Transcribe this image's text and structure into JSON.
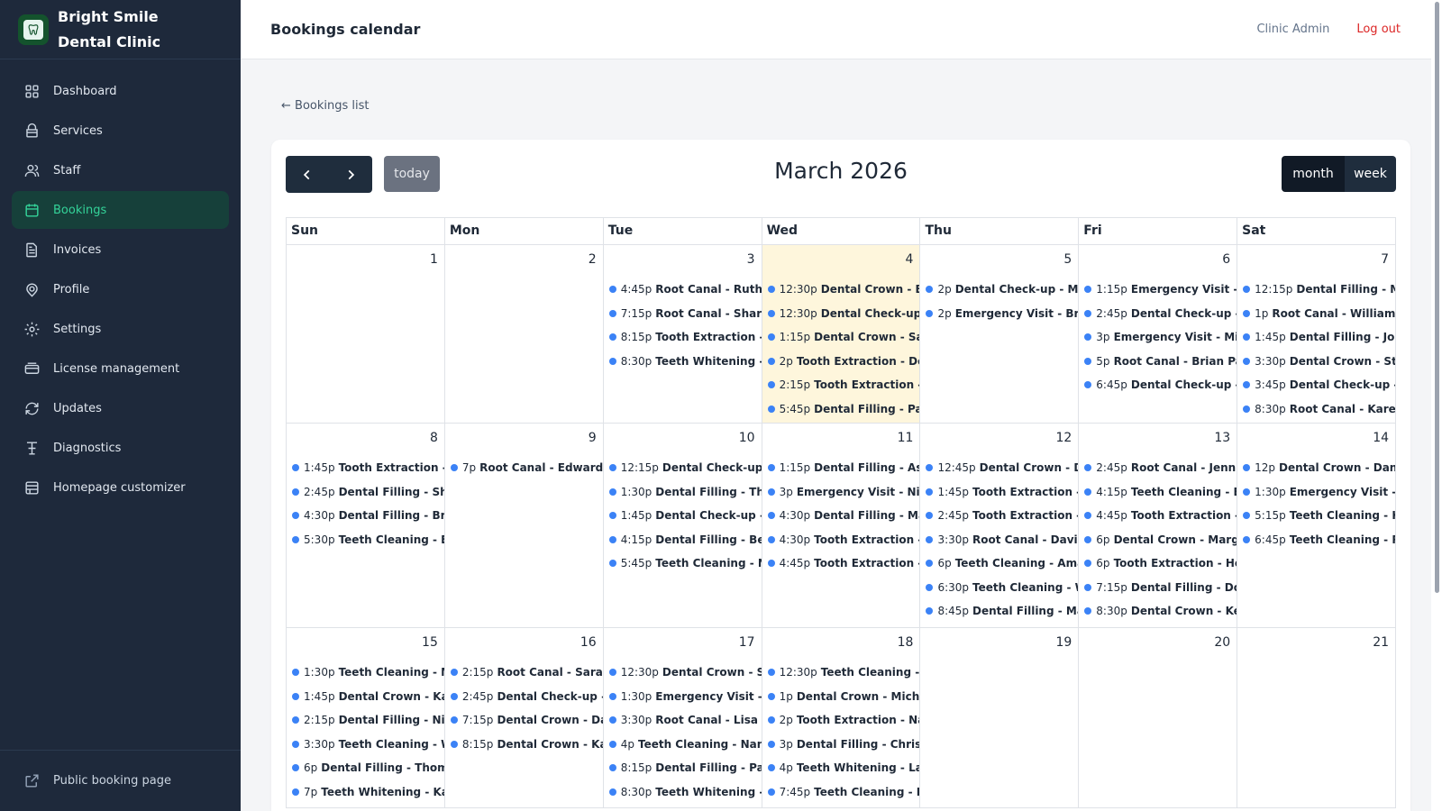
{
  "brand": {
    "name": "Bright Smile Dental Clinic"
  },
  "sidebar": {
    "items": [
      {
        "label": "Dashboard",
        "icon": "grid-icon",
        "name": "sidebar-item-dashboard"
      },
      {
        "label": "Services",
        "icon": "box-icon",
        "name": "sidebar-item-services"
      },
      {
        "label": "Staff",
        "icon": "users-icon",
        "name": "sidebar-item-staff"
      },
      {
        "label": "Bookings",
        "icon": "calendar-icon",
        "name": "sidebar-item-bookings",
        "active": true
      },
      {
        "label": "Invoices",
        "icon": "document-icon",
        "name": "sidebar-item-invoices"
      },
      {
        "label": "Profile",
        "icon": "pin-icon",
        "name": "sidebar-item-profile"
      },
      {
        "label": "Settings",
        "icon": "gear-icon",
        "name": "sidebar-item-settings"
      },
      {
        "label": "License management",
        "icon": "card-icon",
        "name": "sidebar-item-license-management"
      },
      {
        "label": "Updates",
        "icon": "refresh-icon",
        "name": "sidebar-item-updates"
      },
      {
        "label": "Diagnostics",
        "icon": "wrench-icon",
        "name": "sidebar-item-diagnostics"
      },
      {
        "label": "Homepage customizer",
        "icon": "layout-icon",
        "name": "sidebar-item-homepage-customizer"
      }
    ],
    "footer_label": "Public booking page"
  },
  "header": {
    "title": "Bookings calendar",
    "user": "Clinic Admin",
    "logout": "Log out"
  },
  "back_link": "← Bookings list",
  "calendar": {
    "title": "March 2026",
    "today_label": "today",
    "views": {
      "month": "month",
      "week": "week"
    },
    "weekdays": [
      "Sun",
      "Mon",
      "Tue",
      "Wed",
      "Thu",
      "Fri",
      "Sat"
    ],
    "weeks": [
      [
        {
          "day": "1",
          "events": []
        },
        {
          "day": "2",
          "events": []
        },
        {
          "day": "3",
          "events": [
            {
              "time": "4:45p",
              "title": "Root Canal - Ruth C"
            },
            {
              "time": "7:15p",
              "title": "Root Canal - Sharon"
            },
            {
              "time": "8:15p",
              "title": "Tooth Extraction - M"
            },
            {
              "time": "8:30p",
              "title": "Teeth Whitening - R"
            }
          ]
        },
        {
          "day": "4",
          "today": true,
          "events": [
            {
              "time": "12:30p",
              "title": "Dental Crown - Bri"
            },
            {
              "time": "12:30p",
              "title": "Dental Check-up - "
            },
            {
              "time": "1:15p",
              "title": "Dental Crown - Sand"
            },
            {
              "time": "2p",
              "title": "Tooth Extraction - Dor"
            },
            {
              "time": "2:15p",
              "title": "Tooth Extraction - D"
            },
            {
              "time": "5:45p",
              "title": "Dental Filling - Paul"
            }
          ]
        },
        {
          "day": "5",
          "events": [
            {
              "time": "2p",
              "title": "Dental Check-up - Mat"
            },
            {
              "time": "2p",
              "title": "Emergency Visit - Bria"
            }
          ]
        },
        {
          "day": "6",
          "events": [
            {
              "time": "1:15p",
              "title": "Emergency Visit - N"
            },
            {
              "time": "2:45p",
              "title": "Dental Check-up - A"
            },
            {
              "time": "3p",
              "title": "Emergency Visit - Micl"
            },
            {
              "time": "5p",
              "title": "Root Canal - Brian Park"
            },
            {
              "time": "6:45p",
              "title": "Dental Check-up - R"
            }
          ]
        },
        {
          "day": "7",
          "events": [
            {
              "time": "12:15p",
              "title": "Dental Filling - Mar"
            },
            {
              "time": "1p",
              "title": "Root Canal - William M"
            },
            {
              "time": "1:45p",
              "title": "Dental Filling - Josej"
            },
            {
              "time": "3:30p",
              "title": "Dental Crown - Stev"
            },
            {
              "time": "3:45p",
              "title": "Dental Check-up - R"
            },
            {
              "time": "8:30p",
              "title": "Root Canal - Karen W"
            }
          ]
        }
      ],
      [
        {
          "day": "8",
          "events": [
            {
              "time": "1:45p",
              "title": "Tooth Extraction - Je"
            },
            {
              "time": "2:45p",
              "title": "Dental Filling - Shar"
            },
            {
              "time": "4:30p",
              "title": "Dental Filling - Bria"
            },
            {
              "time": "5:30p",
              "title": "Teeth Cleaning - Eli"
            }
          ]
        },
        {
          "day": "9",
          "events": [
            {
              "time": "7p",
              "title": "Root Canal - Edward Ro"
            }
          ]
        },
        {
          "day": "10",
          "events": [
            {
              "time": "12:15p",
              "title": "Dental Check-up - I"
            },
            {
              "time": "1:30p",
              "title": "Dental Filling - Thor"
            },
            {
              "time": "1:45p",
              "title": "Dental Check-up - G"
            },
            {
              "time": "4:15p",
              "title": "Dental Filling - Bett"
            },
            {
              "time": "5:45p",
              "title": "Teeth Cleaning - Ni"
            }
          ]
        },
        {
          "day": "11",
          "events": [
            {
              "time": "1:15p",
              "title": "Dental Filling - Ashle"
            },
            {
              "time": "3p",
              "title": "Emergency Visit - Nicc"
            },
            {
              "time": "4:30p",
              "title": "Dental Filling - Mat"
            },
            {
              "time": "4:30p",
              "title": "Tooth Extraction - J"
            },
            {
              "time": "4:45p",
              "title": "Tooth Extraction - C"
            }
          ]
        },
        {
          "day": "12",
          "events": [
            {
              "time": "12:45p",
              "title": "Dental Crown - Dav"
            },
            {
              "time": "1:45p",
              "title": "Tooth Extraction - E"
            },
            {
              "time": "2:45p",
              "title": "Tooth Extraction - S"
            },
            {
              "time": "3:30p",
              "title": "Root Canal - David M"
            },
            {
              "time": "6p",
              "title": "Teeth Cleaning - Amar"
            },
            {
              "time": "6:30p",
              "title": "Teeth Cleaning - Wi"
            },
            {
              "time": "8:45p",
              "title": "Dental Filling - Mar"
            }
          ]
        },
        {
          "day": "13",
          "events": [
            {
              "time": "2:45p",
              "title": "Root Canal - Jennife"
            },
            {
              "time": "4:15p",
              "title": "Teeth Cleaning - Eli"
            },
            {
              "time": "4:45p",
              "title": "Tooth Extraction - C"
            },
            {
              "time": "6p",
              "title": "Dental Crown - Margai"
            },
            {
              "time": "6p",
              "title": "Tooth Extraction - Hel"
            },
            {
              "time": "7:15p",
              "title": "Dental Filling - Doro"
            },
            {
              "time": "8:30p",
              "title": "Dental Crown - Kev"
            }
          ]
        },
        {
          "day": "14",
          "events": [
            {
              "time": "12p",
              "title": "Dental Crown - Daniel"
            },
            {
              "time": "1:30p",
              "title": "Emergency Visit - A"
            },
            {
              "time": "5:15p",
              "title": "Teeth Cleaning - Ka"
            },
            {
              "time": "6:45p",
              "title": "Teeth Cleaning - Ru"
            }
          ]
        }
      ],
      [
        {
          "day": "15",
          "events": [
            {
              "time": "1:30p",
              "title": "Teeth Cleaning - Mi"
            },
            {
              "time": "1:45p",
              "title": "Dental Crown - Kare"
            },
            {
              "time": "2:15p",
              "title": "Dental Filling - Nico"
            },
            {
              "time": "3:30p",
              "title": "Teeth Cleaning - Wi"
            },
            {
              "time": "6p",
              "title": "Dental Filling - Thoma"
            },
            {
              "time": "7p",
              "title": "Teeth Whitening - Kare"
            }
          ]
        },
        {
          "day": "16",
          "events": [
            {
              "time": "2:15p",
              "title": "Root Canal - Sarah Jo"
            },
            {
              "time": "2:45p",
              "title": "Dental Check-up - Jo"
            },
            {
              "time": "7:15p",
              "title": "Dental Crown - Dani"
            },
            {
              "time": "8:15p",
              "title": "Dental Crown - Kare"
            }
          ]
        },
        {
          "day": "17",
          "events": [
            {
              "time": "12:30p",
              "title": "Dental Crown - Ste"
            },
            {
              "time": "1:30p",
              "title": "Emergency Visit - A"
            },
            {
              "time": "3:30p",
              "title": "Root Canal - Lisa Ed"
            },
            {
              "time": "4p",
              "title": "Teeth Cleaning - Nanc"
            },
            {
              "time": "8:15p",
              "title": "Dental Filling - Paul"
            },
            {
              "time": "8:30p",
              "title": "Teeth Whitening - C"
            }
          ]
        },
        {
          "day": "18",
          "events": [
            {
              "time": "12:30p",
              "title": "Teeth Cleaning - La"
            },
            {
              "time": "1p",
              "title": "Dental Crown - Michae"
            },
            {
              "time": "2p",
              "title": "Tooth Extraction - Nan"
            },
            {
              "time": "3p",
              "title": "Dental Filling - Christo"
            },
            {
              "time": "4p",
              "title": "Teeth Whitening - Lau"
            },
            {
              "time": "7:45p",
              "title": "Teeth Cleaning - Ru"
            }
          ]
        },
        {
          "day": "19",
          "events": []
        },
        {
          "day": "20",
          "events": []
        },
        {
          "day": "21",
          "events": []
        }
      ]
    ]
  },
  "colors": {
    "sidebar_bg": "#1e293b",
    "accent": "#34d399",
    "event_dot": "#3b82f6",
    "today_bg": "#fef6dc",
    "logout": "#dc2626"
  }
}
